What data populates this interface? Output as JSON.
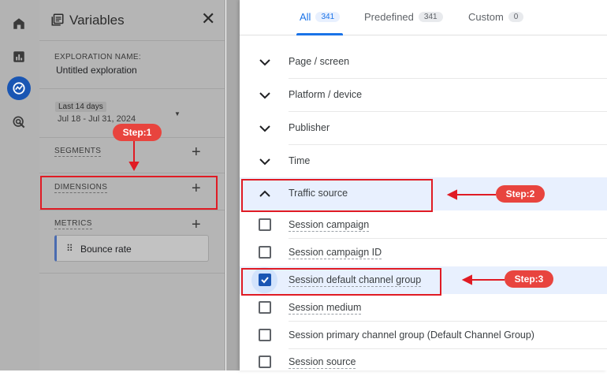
{
  "rail": {
    "items": [
      {
        "icon": "home-icon"
      },
      {
        "icon": "reports-icon"
      },
      {
        "icon": "explore-icon",
        "active": true
      },
      {
        "icon": "advertising-icon"
      }
    ]
  },
  "variables": {
    "title": "Variables",
    "exploration_name_label": "EXPLORATION NAME:",
    "exploration_name_value": "Untitled exploration",
    "date_chip": "Last 14 days",
    "date_range": "Jul 18 - Jul 31, 2024",
    "segments_label": "SEGMENTS",
    "dimensions_label": "DIMENSIONS",
    "metrics_label": "METRICS",
    "metric_item": "Bounce rate",
    "plus_glyph": "+",
    "close_glyph": "✕",
    "dropdown_glyph": "▼",
    "grip_glyph": "⠿"
  },
  "tabs": [
    {
      "label": "All",
      "count": "341"
    },
    {
      "label": "Predefined",
      "count": "341"
    },
    {
      "label": "Custom",
      "count": "0"
    }
  ],
  "categories": [
    {
      "label": "Page / screen",
      "expanded": false
    },
    {
      "label": "Platform / device",
      "expanded": false
    },
    {
      "label": "Publisher",
      "expanded": false
    },
    {
      "label": "Time",
      "expanded": false
    },
    {
      "label": "Traffic source",
      "expanded": true
    }
  ],
  "items": [
    {
      "label": "Session campaign",
      "checked": false
    },
    {
      "label": "Session campaign ID",
      "checked": false
    },
    {
      "label": "Session default channel group",
      "checked": true
    },
    {
      "label": "Session medium",
      "checked": false
    },
    {
      "label": "Session primary channel group (Default Channel Group)",
      "checked": false
    },
    {
      "label": "Session source",
      "checked": false
    }
  ],
  "annotations": {
    "step1": "Step:1",
    "step2": "Step:2",
    "step3": "Step:3"
  },
  "colors": {
    "accent": "#1a73e8",
    "annotation_red": "#e01b24",
    "pill_red": "#e8443e",
    "highlight_row": "#e8f0fe"
  }
}
